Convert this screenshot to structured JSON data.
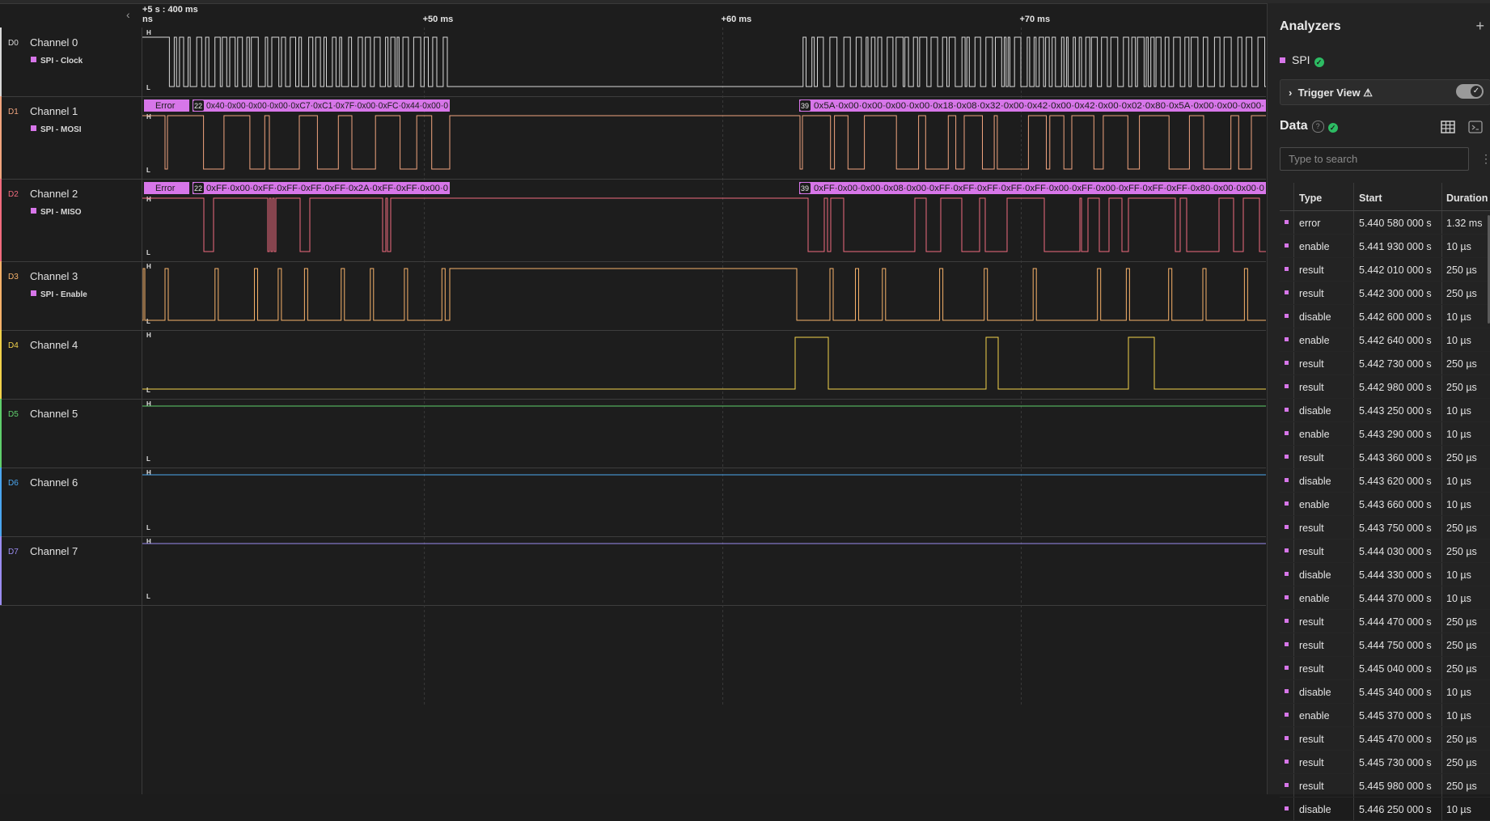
{
  "timeline": {
    "anchor": "+5 s : 400 ms",
    "left_cut": "ns",
    "ticks": [
      {
        "label": "+50 ms",
        "ms": 50
      },
      {
        "label": "+60 ms",
        "ms": 60
      },
      {
        "label": "+70 ms",
        "ms": 70
      }
    ],
    "view_start_ms": 40.55,
    "view_end_ms": 78.2
  },
  "channels": [
    {
      "code": "D0",
      "name": "Channel 0",
      "analyzer": "SPI - Clock",
      "color": "#d9d9d9"
    },
    {
      "code": "D1",
      "name": "Channel 1",
      "analyzer": "SPI - MOSI",
      "color": "#f0a47e"
    },
    {
      "code": "D2",
      "name": "Channel 2",
      "analyzer": "SPI - MISO",
      "color": "#f06b7e"
    },
    {
      "code": "D3",
      "name": "Channel 3",
      "analyzer": "SPI - Enable",
      "color": "#f7b26a"
    },
    {
      "code": "D4",
      "name": "Channel 4",
      "analyzer": "",
      "color": "#f2d24b"
    },
    {
      "code": "D5",
      "name": "Channel 5",
      "analyzer": "",
      "color": "#5fcf6c"
    },
    {
      "code": "D6",
      "name": "Channel 6",
      "analyzer": "",
      "color": "#4aa6f0"
    },
    {
      "code": "D7",
      "name": "Channel 7",
      "analyzer": "",
      "color": "#9b8cf0"
    }
  ],
  "levels": {
    "high": "H",
    "low": "L"
  },
  "decodes": {
    "mosi": {
      "error": "Error",
      "group1_count": "22",
      "group1_text": "0x40·0x00·0x00·0x00·0xC7·0xC1·0x7F·0x00·0xFC·0x44·0x00·0",
      "group2_count": "39",
      "group2_text": "0x5A·0x00·0x00·0x00·0x00·0x18·0x08·0x32·0x00·0x42·0x00·0x42·0x00·0x02·0x80·0x5A·0x00·0x00·0x00·"
    },
    "miso": {
      "error": "Error",
      "group1_count": "22",
      "group1_text": "0xFF·0x00·0xFF·0xFF·0xFF·0xFF·0x2A·0xFF·0xFF·0x00·0",
      "group2_count": "39",
      "group2_text": "0xFF·0x00·0x00·0x08·0x00·0xFF·0xFF·0xFF·0xFF·0xFF·0x00·0xFF·0x00·0xFF·0xFF·0xFF·0x80·0x00·0x00·0"
    },
    "decode_color": "#d776e9"
  },
  "sidepanel": {
    "title": "Analyzers",
    "add": "+",
    "analyzer_name": "SPI",
    "trigger_label": "Trigger View",
    "trigger_warn": "⚠",
    "data_title": "Data",
    "search_placeholder": "Type to search",
    "columns": [
      "Type",
      "Start",
      "Duration"
    ],
    "rows": [
      {
        "type": "error",
        "start": "5.440 580 000 s",
        "duration": "1.32 ms"
      },
      {
        "type": "enable",
        "start": "5.441 930 000 s",
        "duration": "10 µs"
      },
      {
        "type": "result",
        "start": "5.442 010 000 s",
        "duration": "250 µs"
      },
      {
        "type": "result",
        "start": "5.442 300 000 s",
        "duration": "250 µs"
      },
      {
        "type": "disable",
        "start": "5.442 600 000 s",
        "duration": "10 µs"
      },
      {
        "type": "enable",
        "start": "5.442 640 000 s",
        "duration": "10 µs"
      },
      {
        "type": "result",
        "start": "5.442 730 000 s",
        "duration": "250 µs"
      },
      {
        "type": "result",
        "start": "5.442 980 000 s",
        "duration": "250 µs"
      },
      {
        "type": "disable",
        "start": "5.443 250 000 s",
        "duration": "10 µs"
      },
      {
        "type": "enable",
        "start": "5.443 290 000 s",
        "duration": "10 µs"
      },
      {
        "type": "result",
        "start": "5.443 360 000 s",
        "duration": "250 µs"
      },
      {
        "type": "disable",
        "start": "5.443 620 000 s",
        "duration": "10 µs"
      },
      {
        "type": "enable",
        "start": "5.443 660 000 s",
        "duration": "10 µs"
      },
      {
        "type": "result",
        "start": "5.443 750 000 s",
        "duration": "250 µs"
      },
      {
        "type": "result",
        "start": "5.444 030 000 s",
        "duration": "250 µs"
      },
      {
        "type": "disable",
        "start": "5.444 330 000 s",
        "duration": "10 µs"
      },
      {
        "type": "enable",
        "start": "5.444 370 000 s",
        "duration": "10 µs"
      },
      {
        "type": "result",
        "start": "5.444 470 000 s",
        "duration": "250 µs"
      },
      {
        "type": "result",
        "start": "5.444 750 000 s",
        "duration": "250 µs"
      },
      {
        "type": "result",
        "start": "5.445 040 000 s",
        "duration": "250 µs"
      },
      {
        "type": "disable",
        "start": "5.445 340 000 s",
        "duration": "10 µs"
      },
      {
        "type": "enable",
        "start": "5.445 370 000 s",
        "duration": "10 µs"
      },
      {
        "type": "result",
        "start": "5.445 470 000 s",
        "duration": "250 µs"
      },
      {
        "type": "result",
        "start": "5.445 730 000 s",
        "duration": "250 µs"
      },
      {
        "type": "result",
        "start": "5.445 980 000 s",
        "duration": "250 µs"
      },
      {
        "type": "disable",
        "start": "5.446 250 000 s",
        "duration": "10 µs"
      }
    ]
  },
  "icons": {
    "collapse": "chevron-left-icon",
    "status": "check-circle-icon",
    "expand": "chevron-right-icon",
    "help": "help-circle-icon",
    "table": "table-grid-icon",
    "terminal": "terminal-icon",
    "more": "kebab-icon"
  }
}
